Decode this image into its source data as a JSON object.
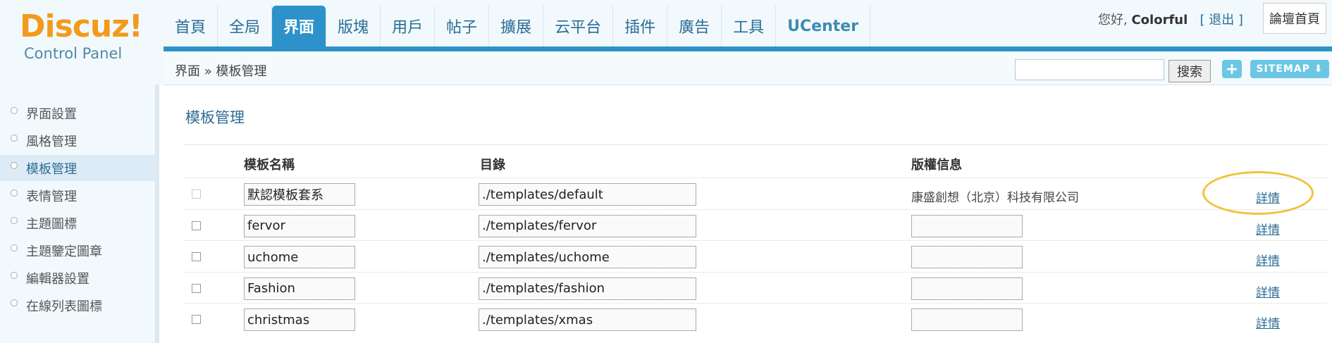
{
  "logo": {
    "main": "Discuz!",
    "sub": "Control Panel"
  },
  "nav": {
    "items": [
      {
        "label": "首頁",
        "active": false
      },
      {
        "label": "全局",
        "active": false
      },
      {
        "label": "界面",
        "active": true
      },
      {
        "label": "版塊",
        "active": false
      },
      {
        "label": "用戶",
        "active": false
      },
      {
        "label": "帖子",
        "active": false
      },
      {
        "label": "擴展",
        "active": false
      },
      {
        "label": "云平台",
        "active": false
      },
      {
        "label": "插件",
        "active": false
      },
      {
        "label": "廣告",
        "active": false
      },
      {
        "label": "工具",
        "active": false
      },
      {
        "label": "UCenter",
        "active": false
      }
    ]
  },
  "user": {
    "greeting": "您好,",
    "name": "Colorful",
    "logout": "[ 退出 ]",
    "home": "論壇首頁"
  },
  "breadcrumb": {
    "text": "界面 » 模板管理"
  },
  "search": {
    "value": "",
    "button": "搜索"
  },
  "toolbar": {
    "plus": "+",
    "sitemap": "SITEMAP ⬇"
  },
  "sidebar": {
    "items": [
      {
        "label": "界面設置",
        "active": false
      },
      {
        "label": "風格管理",
        "active": false
      },
      {
        "label": "模板管理",
        "active": true
      },
      {
        "label": "表情管理",
        "active": false
      },
      {
        "label": "主題圖標",
        "active": false
      },
      {
        "label": "主題鑒定圖章",
        "active": false
      },
      {
        "label": "編輯器設置",
        "active": false
      },
      {
        "label": "在線列表圖標",
        "active": false
      }
    ]
  },
  "main": {
    "title": "模板管理",
    "columns": {
      "name": "模板名稱",
      "dir": "目錄",
      "copyright": "版權信息"
    },
    "rows": [
      {
        "name": "默認模板套系",
        "dir": "./templates/default",
        "copyright": "康盛創想（北京）科技有限公司",
        "detail": "詳情",
        "checkbox_disabled": true
      },
      {
        "name": "fervor",
        "dir": "./templates/fervor",
        "copyright": "",
        "detail": "詳情",
        "checkbox_disabled": false
      },
      {
        "name": "uchome",
        "dir": "./templates/uchome",
        "copyright": "",
        "detail": "詳情",
        "checkbox_disabled": false
      },
      {
        "name": "Fashion",
        "dir": "./templates/fashion",
        "copyright": "",
        "detail": "詳情",
        "checkbox_disabled": false
      },
      {
        "name": "christmas",
        "dir": "./templates/xmas",
        "copyright": "",
        "detail": "詳情",
        "checkbox_disabled": false
      }
    ]
  },
  "colors": {
    "accent": "#2c92c9",
    "logo": "#f39a1c",
    "highlight": "#f0c33a"
  }
}
